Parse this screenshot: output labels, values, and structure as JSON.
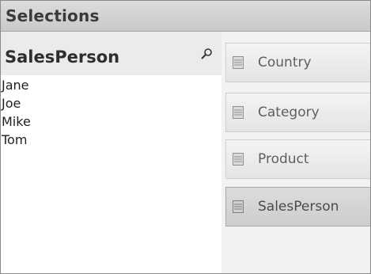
{
  "panel": {
    "title": "Selections"
  },
  "listbox": {
    "title": "SalesPerson",
    "search_icon": "search-icon",
    "items": [
      "Jane",
      "Joe",
      "Mike",
      "Tom"
    ]
  },
  "fields": [
    {
      "label": "Country",
      "icon": "list-icon",
      "selected": false
    },
    {
      "label": "Category",
      "icon": "list-icon",
      "selected": false
    },
    {
      "label": "Product",
      "icon": "list-icon",
      "selected": false
    },
    {
      "label": "SalesPerson",
      "icon": "list-icon",
      "selected": true
    }
  ]
}
